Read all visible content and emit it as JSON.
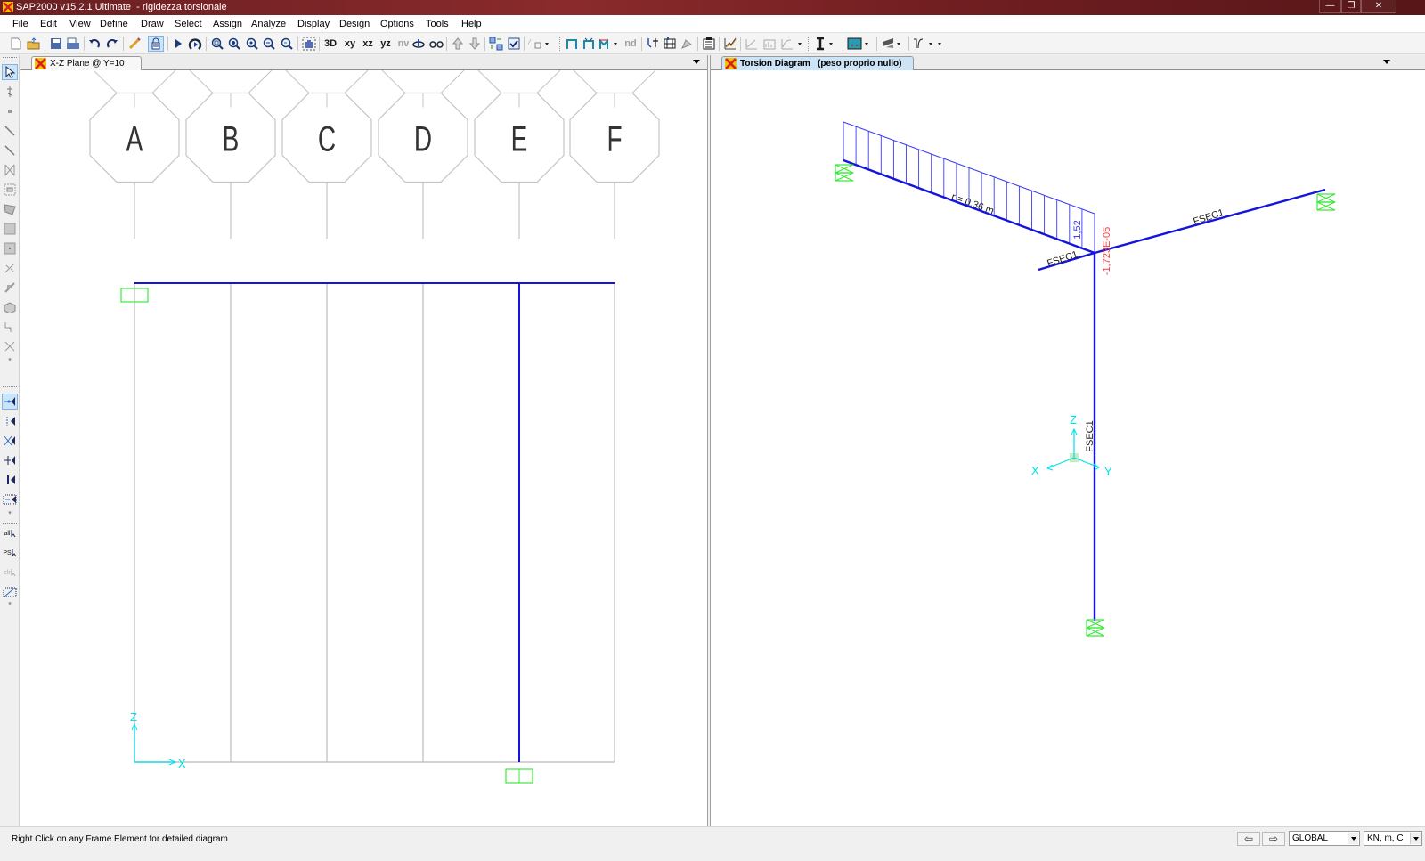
{
  "window": {
    "title": "SAP2000 v15.2.1 Ultimate  - rigidezza torsionale",
    "controls": {
      "minimize": "—",
      "restore": "❐",
      "close": "✕"
    }
  },
  "menu": [
    "File",
    "Edit",
    "View",
    "Define",
    "Draw",
    "Select",
    "Assign",
    "Analyze",
    "Display",
    "Design",
    "Options",
    "Tools",
    "Help"
  ],
  "toolbar": {
    "view_buttons": {
      "threed": "3D",
      "xy": "xy",
      "xz": "xz",
      "yz": "yz",
      "nv": "nv",
      "nd": "nd"
    },
    "icons": [
      "new-model-icon",
      "open-icon",
      "save-icon",
      "print-icon",
      "undo-icon",
      "redo-icon",
      "pencil-icon",
      "lock-icon",
      "run-analysis-icon",
      "run-now-icon",
      "zoom-window-icon",
      "zoom-in-icon",
      "zoom-out-icon",
      "zoom-fit-icon",
      "zoom-previous-icon",
      "pan-icon",
      "set-3d-view-icon",
      "set-xy-view-icon",
      "set-xz-view-icon",
      "set-yz-view-icon",
      "set-nv-view-icon",
      "rotate-view-icon",
      "perspective-icon",
      "move-up-icon",
      "move-down-icon",
      "display-options-icon",
      "refresh-icon",
      "show-undeformed-icon",
      "show-loads-icon",
      "show-deformed-icon",
      "show-forces-icon",
      "show-stresses-icon",
      "show-nd-icon",
      "show-joint-reactions-icon",
      "show-tables-icon",
      "show-virtual-work-icon",
      "show-plot-functions-icon",
      "show-response-icon",
      "show-steps-icon",
      "show-section-cuts-icon",
      "frame-section-icon",
      "area-section-icon",
      "design-icon",
      "function-icon"
    ]
  },
  "left_toolbar": {
    "icons": [
      "pointer-icon",
      "reshape-icon",
      "draw-joint-icon",
      "draw-frame-icon",
      "quick-draw-frame-icon",
      "quick-draw-braces-icon",
      "quick-draw-secondary-icon",
      "draw-poly-area-icon",
      "draw-rect-area-icon",
      "quick-draw-area-icon",
      "draw-link-icon",
      "draw-section-cut-icon",
      "draw-solid-icon",
      "draw-tendon-icon",
      "draw-special-joint-icon",
      "snap-point-icon",
      "snap-end-icon",
      "snap-intersection-icon",
      "snap-perpendicular-icon",
      "snap-lines-icon",
      "snap-fine-grid-icon",
      "select-all-icon",
      "select-previous-icon",
      "clear-selection-icon",
      "select-intersecting-icon"
    ],
    "labels": {
      "all": "all",
      "ps": "PS",
      "clr": "clr"
    }
  },
  "left_pane": {
    "tab_label": "X-Z Plane @ Y=10",
    "grid_bubbles": [
      "A",
      "B",
      "C",
      "D",
      "E",
      "F"
    ],
    "axis_labels": {
      "z": "Z",
      "x": "X"
    }
  },
  "right_pane": {
    "tab_label": "Torsion Diagram   (peso proprio nullo)",
    "diagram": {
      "r_label": "r = 0.36 m",
      "max_value_label": "1,52",
      "end_value_label": "-1,723E-05",
      "section_labels": [
        "FSEC1",
        "FSEC1",
        "FSEC1"
      ],
      "axis_labels": {
        "z": "Z",
        "x": "X",
        "y": "Y"
      }
    }
  },
  "colors": {
    "frame_blue": "#1414dc",
    "diagram_blue": "#3c3cf0",
    "support_green": "#3ce83c",
    "negative_red": "#f04040",
    "axis_cyan": "#00e0f0",
    "grid_gray": "#c4c4c4"
  },
  "status": {
    "message": "Right Click on any Frame Element for detailed diagram",
    "prev_label": "⇦",
    "next_label": "⇨",
    "coord_system": "GLOBAL",
    "units": "KN, m, C"
  }
}
